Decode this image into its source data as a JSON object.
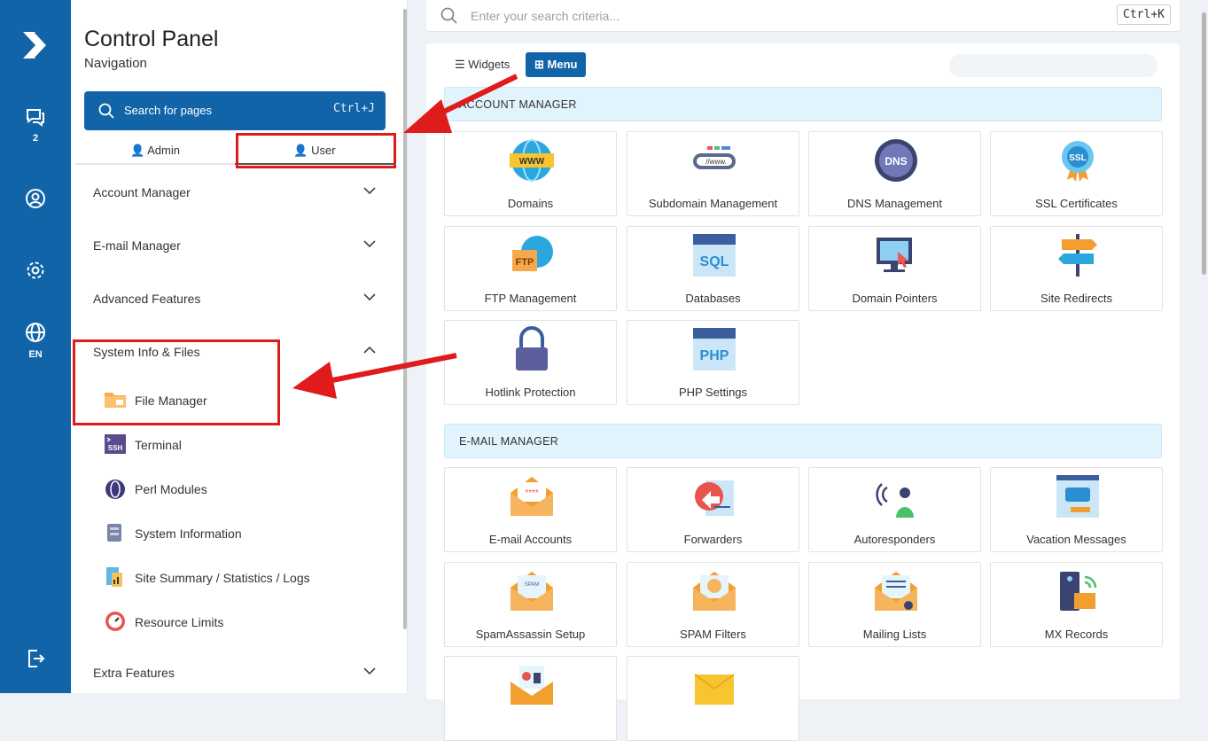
{
  "rail": {
    "chat_count": "2",
    "language": "EN"
  },
  "nav": {
    "title": "Control Panel",
    "subtitle": "Navigation",
    "search_label": "Search for pages",
    "search_kbd": "Ctrl+J",
    "tabs": {
      "admin": "Admin",
      "user": "User"
    },
    "sections": {
      "account": "Account Manager",
      "email": "E-mail Manager",
      "advanced": "Advanced Features",
      "system": "System Info & Files",
      "extra": "Extra Features"
    },
    "items": [
      {
        "label": "File Manager",
        "icon": "folder-icon"
      },
      {
        "label": "Terminal",
        "icon": "ssh-terminal-icon"
      },
      {
        "label": "Perl Modules",
        "icon": "perl-onion-icon"
      },
      {
        "label": "System Information",
        "icon": "system-info-icon"
      },
      {
        "label": "Site Summary / Statistics / Logs",
        "icon": "statistics-icon"
      },
      {
        "label": "Resource Limits",
        "icon": "gauge-icon"
      }
    ]
  },
  "top_search": {
    "placeholder": "Enter your search criteria...",
    "kbd": "Ctrl+K"
  },
  "view_toggle": {
    "widgets": "Widgets",
    "menu": "Menu"
  },
  "groups": {
    "account_title": "ACCOUNT MANAGER",
    "email_title": "E-MAIL MANAGER"
  },
  "account_cards": [
    "Domains",
    "Subdomain Management",
    "DNS Management",
    "SSL Certificates",
    "FTP Management",
    "Databases",
    "Domain Pointers",
    "Site Redirects",
    "Hotlink Protection",
    "PHP Settings"
  ],
  "email_cards": [
    "E-mail Accounts",
    "Forwarders",
    "Autoresponders",
    "Vacation Messages",
    "SpamAssassin Setup",
    "SPAM Filters",
    "Mailing Lists",
    "MX Records"
  ],
  "colors": {
    "brand": "#1164a8",
    "highlight": "#e01b1b",
    "band": "#e1f3fd"
  }
}
